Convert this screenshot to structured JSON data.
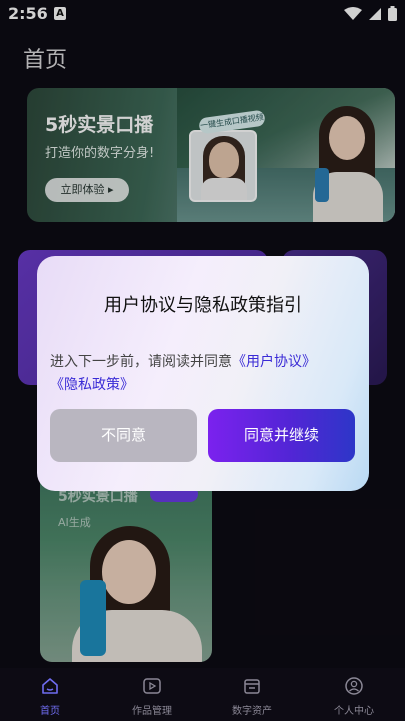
{
  "status_bar": {
    "time": "2:56",
    "notification_letter": "A"
  },
  "page": {
    "title": "首页"
  },
  "banner": {
    "title": "5秒实景口播",
    "subtitle": "打造你的数字分身!",
    "button_label": "立即体验 ▸",
    "tag": "一键生成口播视频"
  },
  "bottom_card": {
    "title": "5秒实景口播",
    "caption": "AI生成"
  },
  "dialog": {
    "title": "用户协议与隐私政策指引",
    "body_prefix": "进入下一步前，请阅读并同意",
    "user_agreement_link": "《用户协议》",
    "privacy_policy_link": "《隐私政策》",
    "disagree_label": "不同意",
    "agree_label": "同意并继续"
  },
  "bottom_nav": {
    "items": [
      {
        "label": "首页",
        "icon": "home-icon",
        "active": true
      },
      {
        "label": "作品管理",
        "icon": "video-icon",
        "active": false
      },
      {
        "label": "数字资产",
        "icon": "store-icon",
        "active": false
      },
      {
        "label": "个人中心",
        "icon": "person-icon",
        "active": false
      }
    ]
  },
  "colors": {
    "background": "#0d0b14",
    "accent": "#6f6cf0",
    "agree_gradient_start": "#7b22ee",
    "agree_gradient_end": "#2d36c8",
    "disagree": "#b9b6c0",
    "link": "#3a2bd6"
  }
}
